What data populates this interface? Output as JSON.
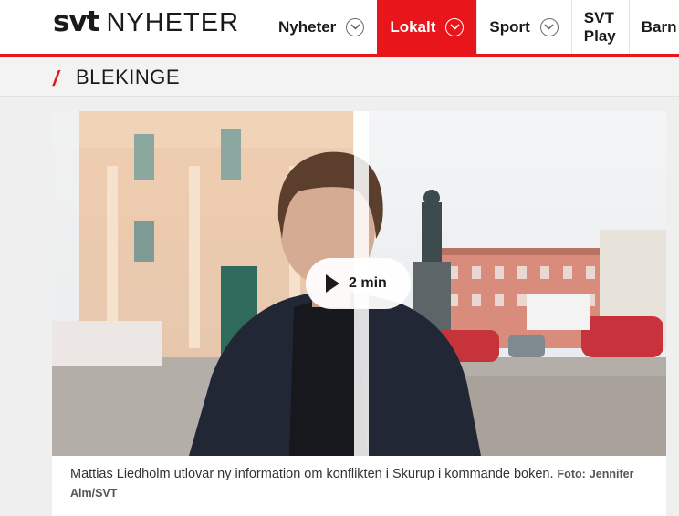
{
  "header": {
    "logo_brand": "svt",
    "logo_section": "NYHETER",
    "nav": [
      {
        "label": "Nyheter",
        "has_dropdown": true,
        "active": false
      },
      {
        "label": "Lokalt",
        "has_dropdown": true,
        "active": true
      },
      {
        "label": "Sport",
        "has_dropdown": true,
        "active": false
      },
      {
        "label": "SVT Play",
        "has_dropdown": false,
        "active": false
      },
      {
        "label": "Barn",
        "has_dropdown": false,
        "active": false
      }
    ]
  },
  "region": {
    "slash": "/",
    "name": "BLEKINGE"
  },
  "article": {
    "video": {
      "duration": "2 min",
      "play_icon": "play-icon"
    },
    "caption": "Mattias Liedholm utlovar ny information om konflikten i Skurup i kommande boken.",
    "credit_label": "Foto:",
    "credit": "Jennifer Alm/SVT"
  },
  "colors": {
    "brand_red": "#e8161b",
    "text": "#1a1a1a",
    "background": "#efefef"
  }
}
